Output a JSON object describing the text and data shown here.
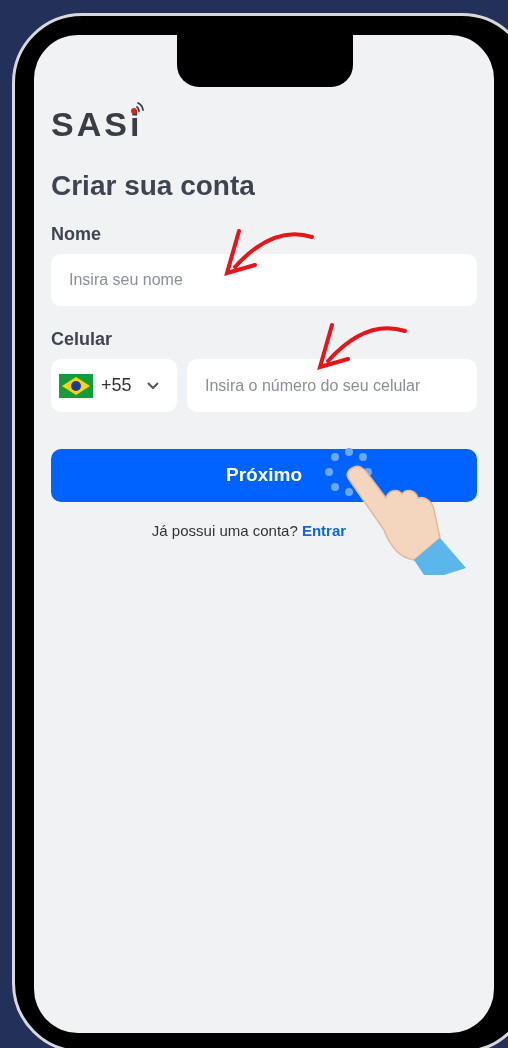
{
  "logo": {
    "text": "SASi"
  },
  "title": "Criar sua conta",
  "name_field": {
    "label": "Nome",
    "placeholder": "Insira seu nome"
  },
  "phone_field": {
    "label": "Celular",
    "country_code": "+55",
    "placeholder": "Insira o número do seu celular"
  },
  "submit_button": {
    "label": "Próximo"
  },
  "login_prompt": {
    "text": "Já possui uma conta?",
    "link": "Entrar"
  }
}
